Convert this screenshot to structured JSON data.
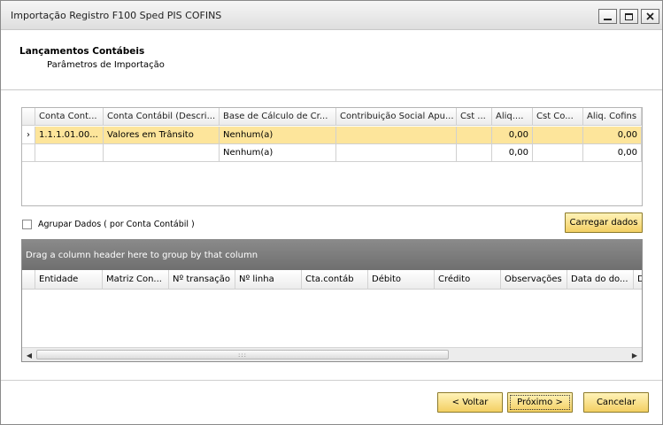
{
  "window": {
    "title": "Importação Registro F100 Sped PIS COFINS",
    "minimize_glyph": "▁",
    "maximize_glyph": "□",
    "close_glyph": "✕"
  },
  "header": {
    "title": "Lançamentos Contábeis",
    "subtitle": "Parâmetros de Importação"
  },
  "grid1": {
    "columns": [
      "Conta Cont...",
      "Conta Contábil (Descri...",
      "Base de Cálculo de Cr...",
      "Contribuição Social Apu...",
      "Cst ...",
      "Aliq....",
      "Cst Co...",
      "Aliq. Cofins"
    ],
    "row_indicator": "›",
    "rows": [
      [
        "1.1.1.01.00...",
        "Valores em Trânsito",
        "Nenhum(a)",
        "",
        "",
        "0,00",
        "",
        "0,00"
      ],
      [
        "",
        "",
        "Nenhum(a)",
        "",
        "",
        "0,00",
        "",
        "0,00"
      ]
    ]
  },
  "group_option": {
    "label": "Agrupar Dados  ( por Conta Contábil )",
    "checked": false
  },
  "load_button": "Carregar dados",
  "grid2": {
    "group_hint": "Drag a column header here to group by that column",
    "columns": [
      "Entidade",
      "Matriz Con...",
      "Nº transação",
      "Nº linha",
      "Cta.contáb",
      "Débito",
      "Crédito",
      "Observações",
      "Data do do...",
      "D"
    ],
    "scroll_left": "◀",
    "scroll_right": "▶",
    "thumb_grip": ":::"
  },
  "footer": {
    "back": "< Voltar",
    "next": "Próximo >",
    "cancel": "Cancelar"
  },
  "colors": {
    "selected_row": "#fde59b",
    "button_top": "#fff3b8",
    "button_bottom": "#f3cf63",
    "group_panel": "#7a7a7a"
  }
}
